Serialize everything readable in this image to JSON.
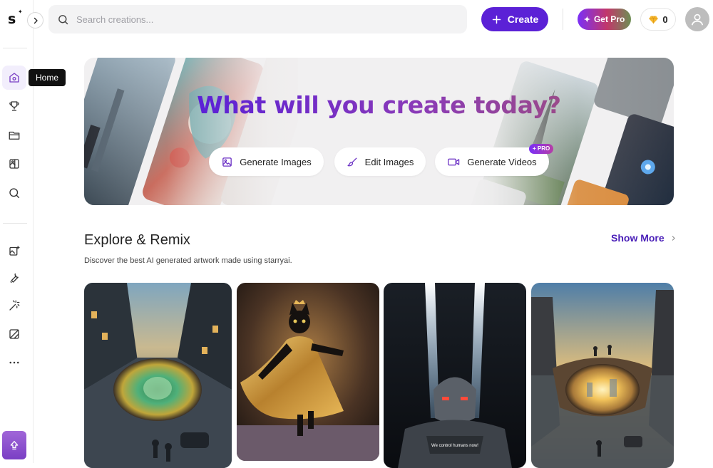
{
  "sidebar": {
    "logo_letter": "s",
    "tooltip": "Home",
    "nav": [
      {
        "name": "home",
        "icon": "home-icon"
      },
      {
        "name": "trophy",
        "icon": "trophy-icon"
      },
      {
        "name": "folder",
        "icon": "folder-icon"
      },
      {
        "name": "gallery",
        "icon": "gallery-icon"
      },
      {
        "name": "search",
        "icon": "search-icon"
      },
      {
        "name": "create-image",
        "icon": "image-plus-icon"
      },
      {
        "name": "edit",
        "icon": "wrench-icon"
      },
      {
        "name": "magic",
        "icon": "magic-wand-icon"
      },
      {
        "name": "frame",
        "icon": "frame-icon"
      },
      {
        "name": "more",
        "icon": "more-icon"
      }
    ]
  },
  "topbar": {
    "search_placeholder": "Search creations...",
    "create_label": "Create",
    "get_pro_label": "Get Pro",
    "credits": "0"
  },
  "hero": {
    "title": "What will you create today?",
    "buttons": [
      {
        "label": "Generate Images",
        "icon": "image-icon"
      },
      {
        "label": "Edit Images",
        "icon": "brush-icon"
      },
      {
        "label": "Generate Videos",
        "icon": "video-icon"
      }
    ],
    "pro_tag": "+ PRO"
  },
  "explore": {
    "title": "Explore & Remix",
    "subtitle": "Discover the best AI generated artwork made using starryai.",
    "show_more": "Show More",
    "cards": [
      {
        "name": "card-city-portal"
      },
      {
        "name": "card-cat-dress"
      },
      {
        "name": "card-robot",
        "caption": "We control humans now!"
      },
      {
        "name": "card-street-portal"
      }
    ]
  },
  "colors": {
    "accent": "#5b21d6",
    "title_purple": "#6a2fc4",
    "show_more": "#4a1fb8"
  }
}
